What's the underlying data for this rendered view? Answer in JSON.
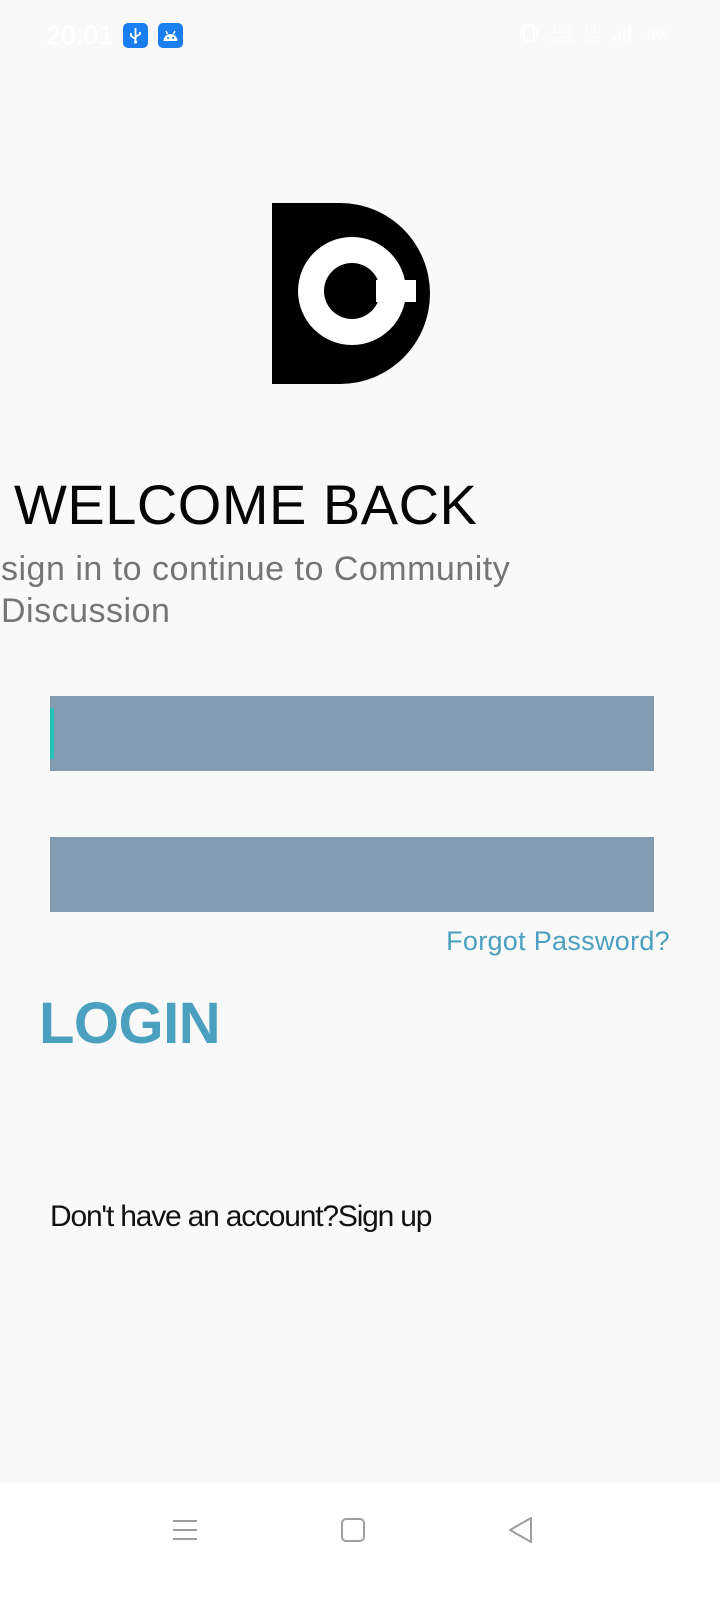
{
  "status_bar": {
    "time": "20:01",
    "notification_icons": [
      "usb-icon",
      "android-icon"
    ],
    "right_icons": [
      "vibrate-icon",
      "network-speed-icon",
      "hd-volte-icon",
      "signal-icon",
      "battery-icon"
    ],
    "network_speed": "12.0\nKB/S",
    "battery": "8%"
  },
  "logo": {
    "name": "community-discussion-logo"
  },
  "header": {
    "title": "WELCOME BACK",
    "subtitle": "sign in to continue to Community Discussion"
  },
  "form": {
    "email_placeholder": "",
    "password_placeholder": "",
    "forgot_password": "Forgot Password?",
    "login_label": "LOGIN"
  },
  "footer": {
    "signup_prompt": "Don't have an account?",
    "signup_link": "Sign up"
  },
  "nav_bar": {
    "buttons": [
      "menu-icon",
      "home-icon",
      "back-icon"
    ]
  },
  "colors": {
    "background": "#f9f9f9",
    "field": "#839cb2",
    "accent": "#4aa0be",
    "cursor": "#23c2b6"
  }
}
